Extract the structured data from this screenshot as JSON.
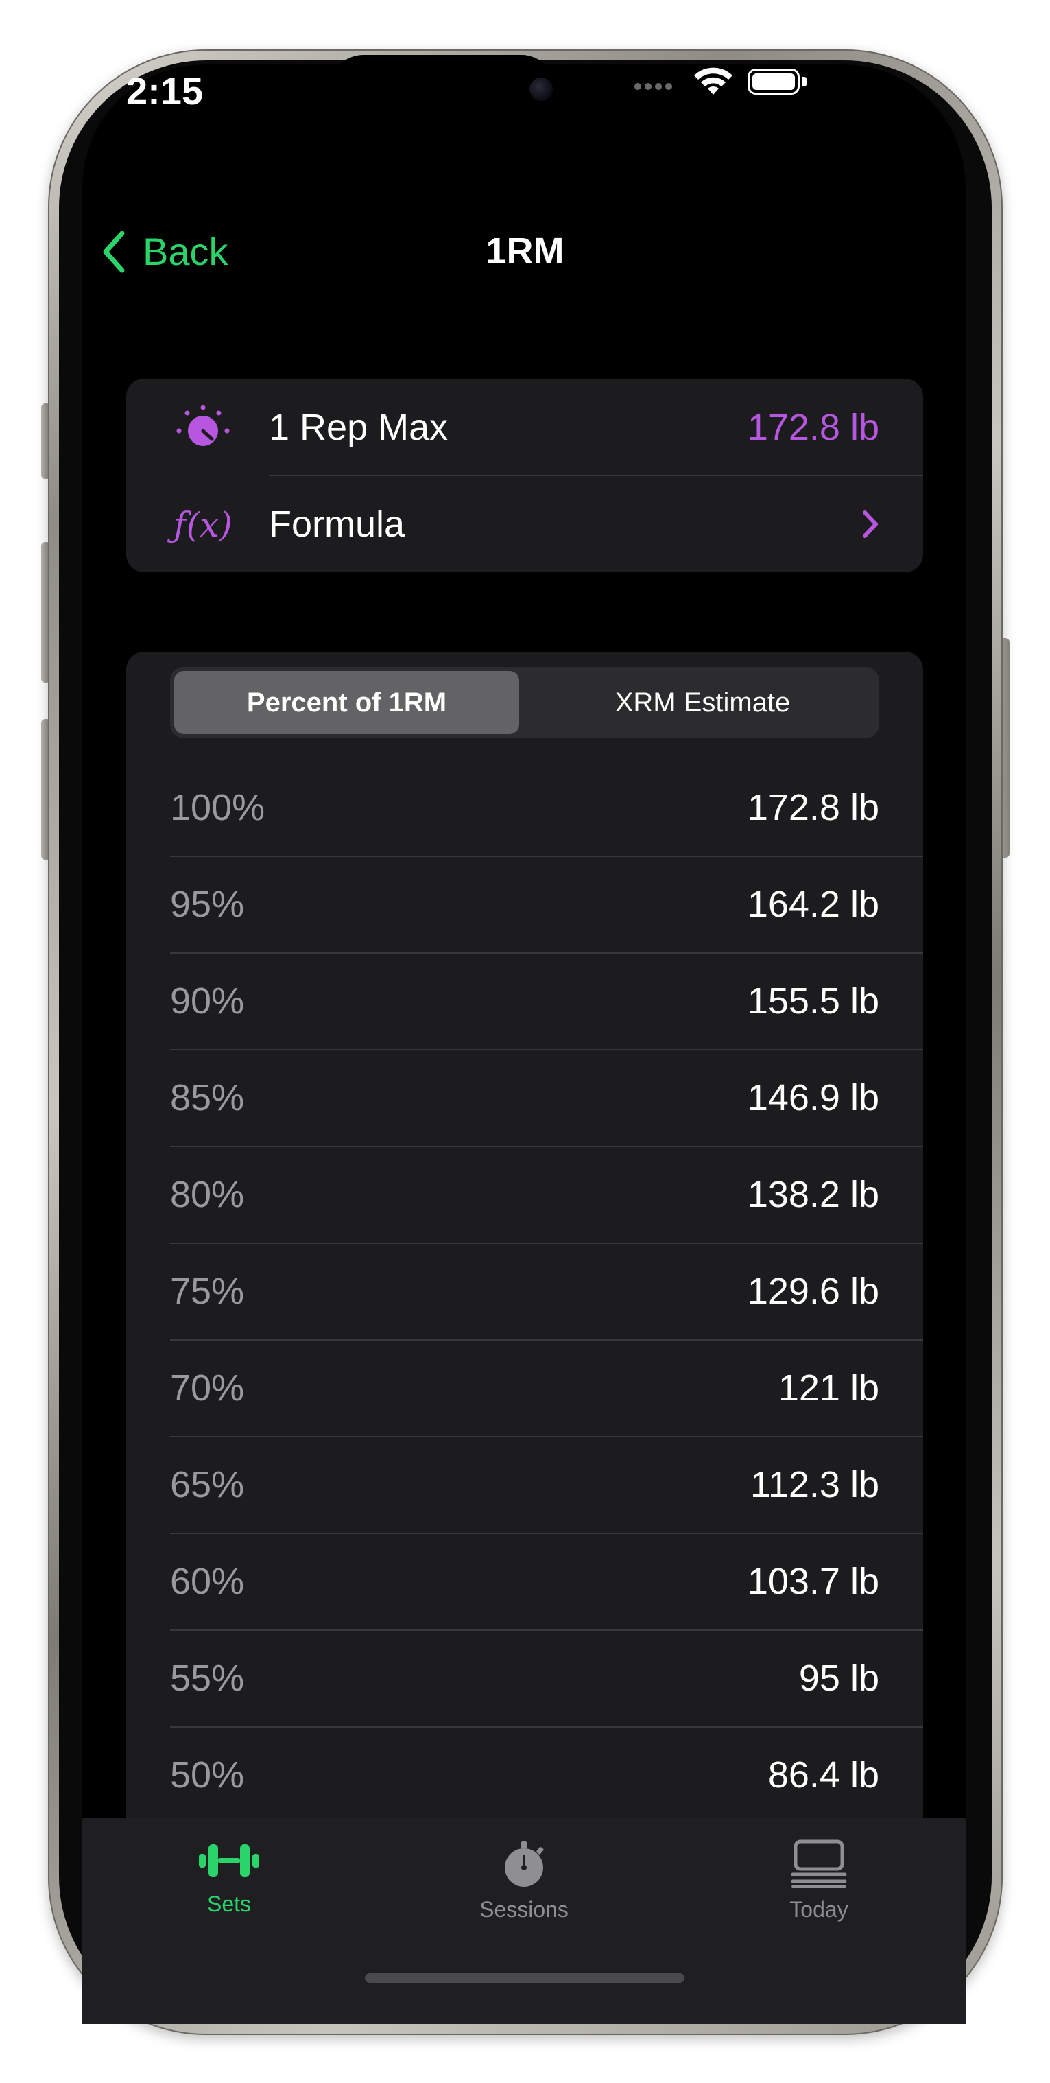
{
  "status": {
    "time": "2:15"
  },
  "nav": {
    "back_label": "Back",
    "title": "1RM"
  },
  "info": {
    "one_rep_max_label": "1 Rep Max",
    "one_rep_max_value": "172.8 lb",
    "formula_label": "Formula",
    "formula_icon_text": "ƒ(x)"
  },
  "segmented": {
    "options": [
      "Percent of 1RM",
      "XRM Estimate"
    ],
    "selected": "Percent of 1RM"
  },
  "table": {
    "rows": [
      {
        "percent": "100%",
        "weight": "172.8 lb"
      },
      {
        "percent": "95%",
        "weight": "164.2 lb"
      },
      {
        "percent": "90%",
        "weight": "155.5 lb"
      },
      {
        "percent": "85%",
        "weight": "146.9 lb"
      },
      {
        "percent": "80%",
        "weight": "138.2 lb"
      },
      {
        "percent": "75%",
        "weight": "129.6 lb"
      },
      {
        "percent": "70%",
        "weight": "121 lb"
      },
      {
        "percent": "65%",
        "weight": "112.3 lb"
      },
      {
        "percent": "60%",
        "weight": "103.7 lb"
      },
      {
        "percent": "55%",
        "weight": "95 lb"
      },
      {
        "percent": "50%",
        "weight": "86.4 lb"
      }
    ]
  },
  "tabbar": {
    "tabs": [
      {
        "label": "Sets"
      },
      {
        "label": "Sessions"
      },
      {
        "label": "Today"
      }
    ],
    "active": "Sets"
  },
  "colors": {
    "accent_green": "#2bd46a",
    "accent_purple": "#b757e0",
    "background": "#000000",
    "card": "#1c1c1e"
  },
  "icons": [
    "chevron-left-icon",
    "gauge-icon",
    "function-icon",
    "chevron-right-icon",
    "dumbbell-icon",
    "stopwatch-icon",
    "today-icon",
    "wifi-icon",
    "battery-icon"
  ]
}
